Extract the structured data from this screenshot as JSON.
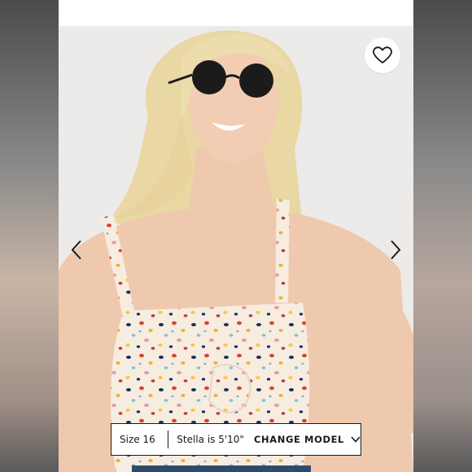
{
  "product": {
    "image_alt": "Model wearing a multicolor terrazzo-print square-neck tank top with sunglasses",
    "favorite_icon": "heart-outline-icon"
  },
  "carousel": {
    "prev_icon": "chevron-left-icon",
    "next_icon": "chevron-right-icon"
  },
  "model_bar": {
    "size_text": "Size 16",
    "model_text": "Stella is 5'10\"",
    "change_label": "CHANGE MODEL",
    "change_icon": "chevron-down-icon"
  },
  "colors": {
    "accent": "#1a1a1a",
    "background": "#ecebea"
  }
}
